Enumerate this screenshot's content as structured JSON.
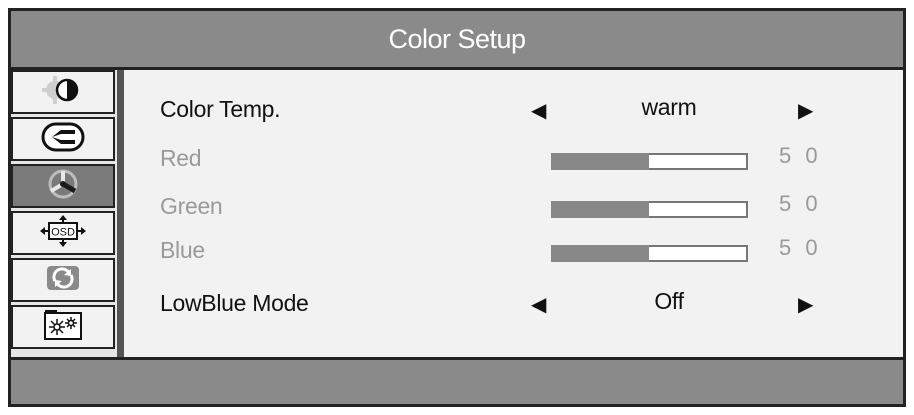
{
  "window": {
    "title": "Color Setup"
  },
  "sidebar": {
    "tabs": [
      {
        "icon": "brightness-contrast-icon",
        "active": false
      },
      {
        "icon": "display-input-icon",
        "active": false
      },
      {
        "icon": "color-setup-icon",
        "active": true
      },
      {
        "icon": "osd-position-icon",
        "active": false,
        "text": "OSD"
      },
      {
        "icon": "reset-icon",
        "active": false
      },
      {
        "icon": "misc-settings-icon",
        "active": false
      }
    ]
  },
  "settings": {
    "color_temp": {
      "label": "Color Temp.",
      "value": "warm"
    },
    "red": {
      "label": "Red",
      "value": "5 0",
      "level": 0.5
    },
    "green": {
      "label": "Green",
      "value": "5 0",
      "level": 0.5
    },
    "blue": {
      "label": "Blue",
      "value": "5 0",
      "level": 0.5
    },
    "lowblue": {
      "label": "LowBlue Mode",
      "value": "Off"
    }
  },
  "arrows": {
    "left": "◀",
    "right": "▶"
  },
  "colors": {
    "frame": "#222222",
    "header": "#8a8a8a",
    "panel": "#f2f2f2",
    "inactive_text": "#9a9a9a",
    "active_tab": "#7a7a7a"
  }
}
